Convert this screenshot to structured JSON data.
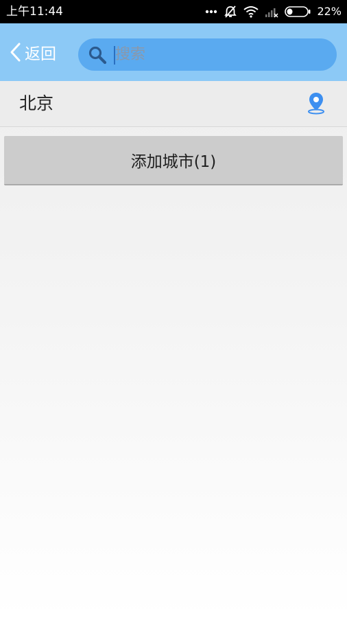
{
  "status_bar": {
    "time": "上午11:44",
    "battery_percent": "22%",
    "icons": [
      "more-dots-icon",
      "alarm-muted-icon",
      "wifi-icon",
      "signal-no-sim-icon",
      "battery-icon"
    ]
  },
  "header": {
    "back_label": "返回",
    "back_icon": "chevron-left-icon",
    "search": {
      "placeholder": "搜索",
      "value": "",
      "icon": "search-icon"
    }
  },
  "cities": [
    {
      "name": "北京",
      "icon": "location-pin-icon"
    }
  ],
  "add_city_button": {
    "label": "添加城市(1)"
  },
  "colors": {
    "header_bg": "#8cc9f6",
    "search_bg": "#5aaaf0",
    "accent_blue": "#3d8ff0",
    "button_bg": "#cccccc"
  }
}
